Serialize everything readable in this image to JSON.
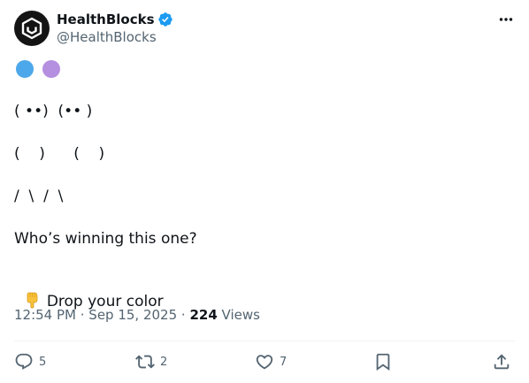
{
  "post": {
    "author": {
      "display_name": "HealthBlocks",
      "handle": "@HealthBlocks",
      "verified": true
    },
    "dot_colors": [
      "#4ca8ea",
      "#b58fe0"
    ],
    "lines": {
      "faces": "( ••)  (•• )",
      "bodies": "(    )      (    )",
      "legs": "/  \\  /  \\",
      "question": "Who’s winning this one?",
      "call_to_action": "Drop your color"
    },
    "call_to_action_emoji": "backhand-index-pointing-down-icon",
    "timestamp": {
      "time": "12:54 PM",
      "separator1": " · ",
      "date": "Sep 15, 2025",
      "separator2": " · ",
      "views_count": "224",
      "views_label": " Views"
    },
    "stats": {
      "replies": "5",
      "reposts": "2",
      "likes": "7"
    }
  },
  "colors": {
    "verified_blue": "#1d9bf0",
    "text_primary": "#0f1419",
    "text_secondary": "#536471"
  }
}
